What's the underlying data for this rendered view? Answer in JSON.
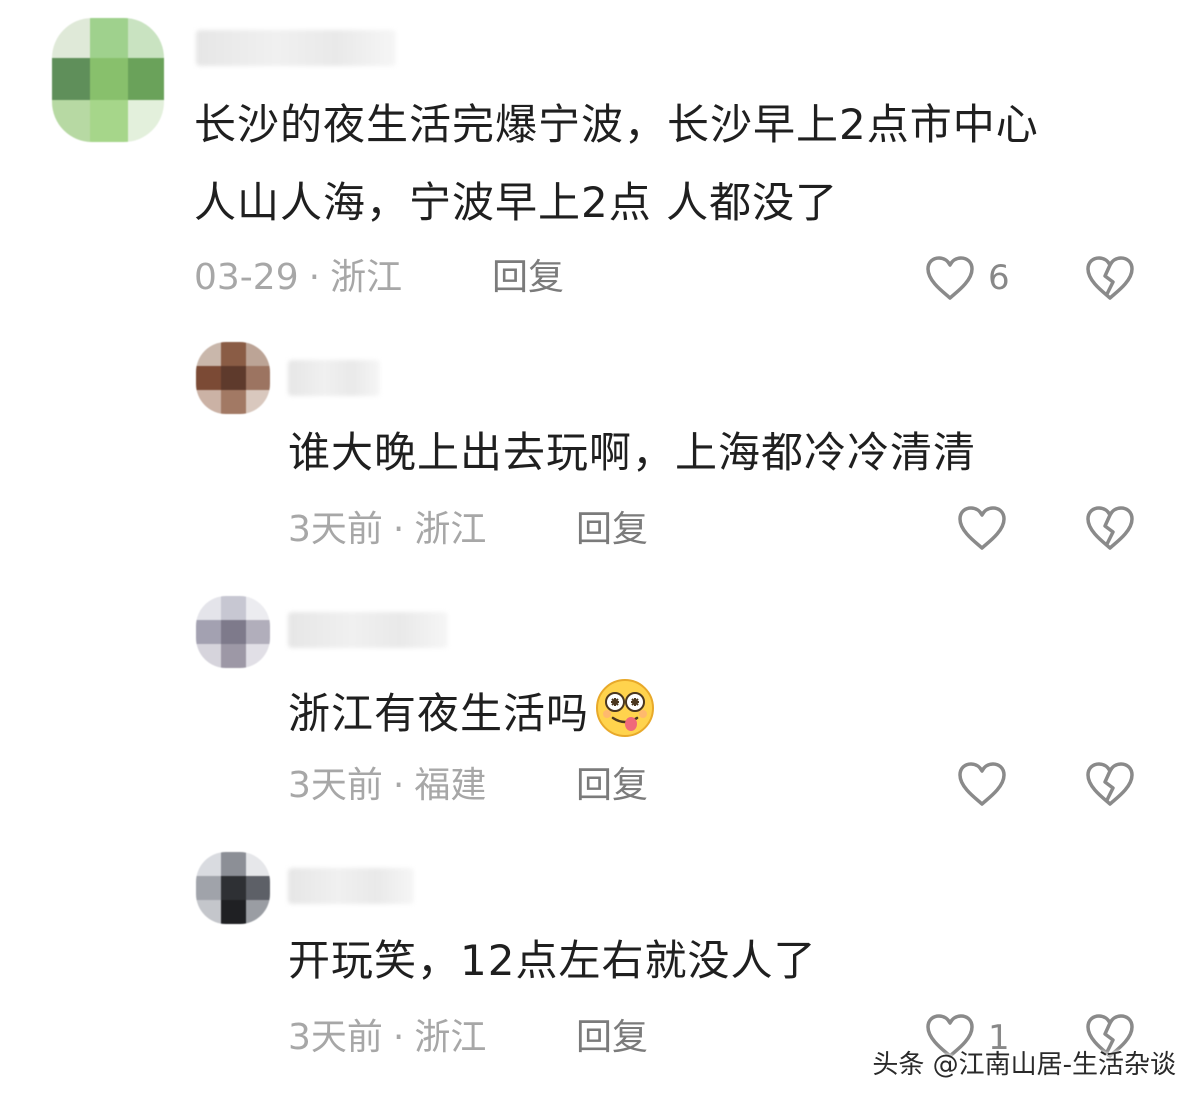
{
  "comments": [
    {
      "text_lines": [
        "长沙的夜生活完爆宁波，长沙早上2点市中心",
        "人山人海，宁波早上2点 人都没了"
      ],
      "time": "03-29",
      "location": "浙江",
      "reply_label": "回复",
      "like_count": "6",
      "like_icon": "heart-outline-icon",
      "dislike_icon": "broken-heart-icon"
    },
    {
      "text_lines": [
        "谁大晚上出去玩啊，上海都冷冷清清"
      ],
      "time": "3天前",
      "location": "浙江",
      "reply_label": "回复",
      "like_count": "",
      "like_icon": "heart-outline-icon",
      "dislike_icon": "broken-heart-icon"
    },
    {
      "text_lines": [
        "浙江有夜生活吗"
      ],
      "emoji": "dizzy-tongue-emoji",
      "time": "3天前",
      "location": "福建",
      "reply_label": "回复",
      "like_count": "",
      "like_icon": "heart-outline-icon",
      "dislike_icon": "broken-heart-icon"
    },
    {
      "text_lines": [
        "开玩笑，12点左右就没人了"
      ],
      "time": "3天前",
      "location": "浙江",
      "reply_label": "回复",
      "like_count": "1",
      "like_icon": "heart-outline-icon",
      "dislike_icon": "broken-heart-icon"
    }
  ],
  "meta_separator": "·",
  "watermark": "头条 @江南山居-生活杂谈",
  "colors": {
    "text": "#1f1f1f",
    "meta": "#a7a7a7",
    "reply": "#7b7b7b",
    "icon": "#8a8a8a"
  }
}
